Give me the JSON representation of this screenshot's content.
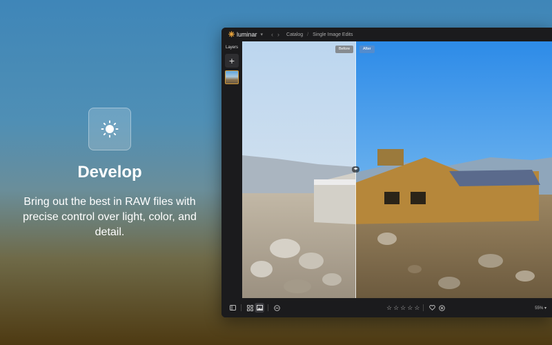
{
  "promo": {
    "icon": "sun-icon",
    "title": "Develop",
    "body": "Bring out the best in RAW files with precise control over light, color, and detail."
  },
  "app": {
    "logo": "luminar",
    "breadcrumbs": [
      "Catalog",
      "Single Image Edits"
    ],
    "sidebar": {
      "layers_label": "Layers",
      "add_layer": "+"
    },
    "canvas": {
      "before_label": "Before",
      "after_label": "After",
      "split_handle": "◂▸"
    },
    "bottombar": {
      "zoom": "55%",
      "rating_stars": [
        "☆",
        "☆",
        "☆",
        "☆",
        "☆"
      ]
    }
  },
  "colors": {
    "accent": "#e6a23c",
    "after_tag": "#5a8cc8",
    "app_bg": "#1b1b1d"
  }
}
